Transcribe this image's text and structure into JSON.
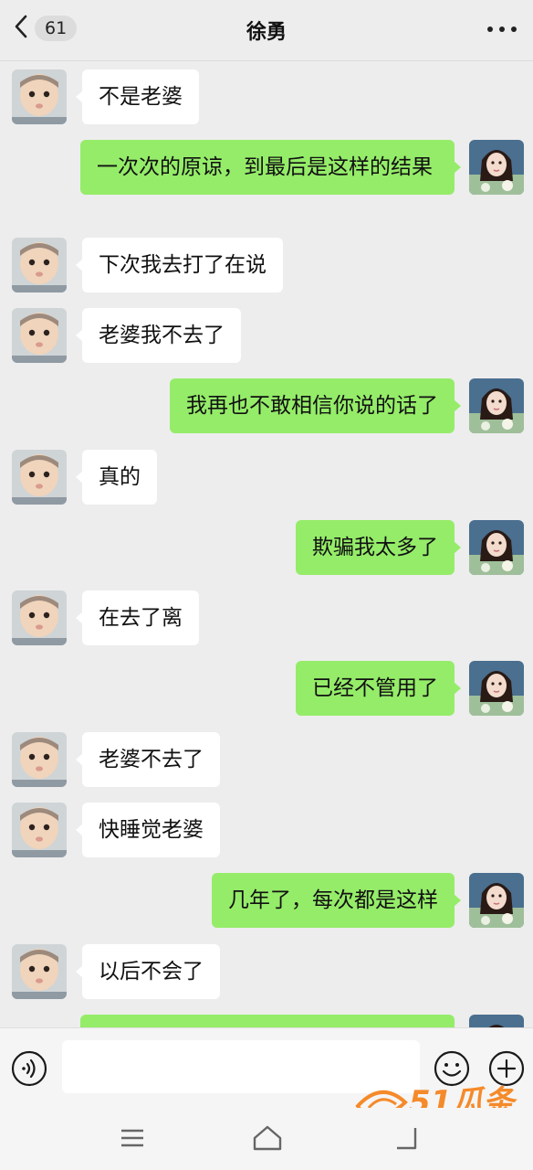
{
  "header": {
    "unread_count": "61",
    "title": "徐勇"
  },
  "messages": [
    {
      "side": "left",
      "text": "不是老婆"
    },
    {
      "side": "right",
      "text": "一次次的原谅，到最后是这样的结果"
    },
    {
      "side": "left",
      "text": "下次我去打了在说"
    },
    {
      "side": "left",
      "text": "老婆我不去了"
    },
    {
      "side": "right",
      "text": "我再也不敢相信你说的话了"
    },
    {
      "side": "left",
      "text": "真的"
    },
    {
      "side": "right",
      "text": "欺骗我太多了"
    },
    {
      "side": "left",
      "text": "在去了离"
    },
    {
      "side": "right",
      "text": "已经不管用了"
    },
    {
      "side": "left",
      "text": "老婆不去了"
    },
    {
      "side": "left",
      "text": "快睡觉老婆"
    },
    {
      "side": "right",
      "text": "几年了，每次都是这样"
    },
    {
      "side": "left",
      "text": "以后不会了"
    }
  ],
  "input": {
    "value": "",
    "placeholder": ""
  },
  "watermark": {
    "text": "51瓜条"
  },
  "icons": {
    "back": "chevron-left-icon",
    "more": "more-dots-icon",
    "voice": "voice-icon",
    "emoji": "emoji-icon",
    "plus": "plus-icon",
    "nav_menu": "menu-icon",
    "nav_home": "home-icon",
    "nav_back": "back-icon"
  },
  "colors": {
    "background": "#ededed",
    "bubble_sent": "#95ec69",
    "bubble_received": "#ffffff",
    "input_bar": "#f5f5f5",
    "watermark": "#f58a2a"
  }
}
